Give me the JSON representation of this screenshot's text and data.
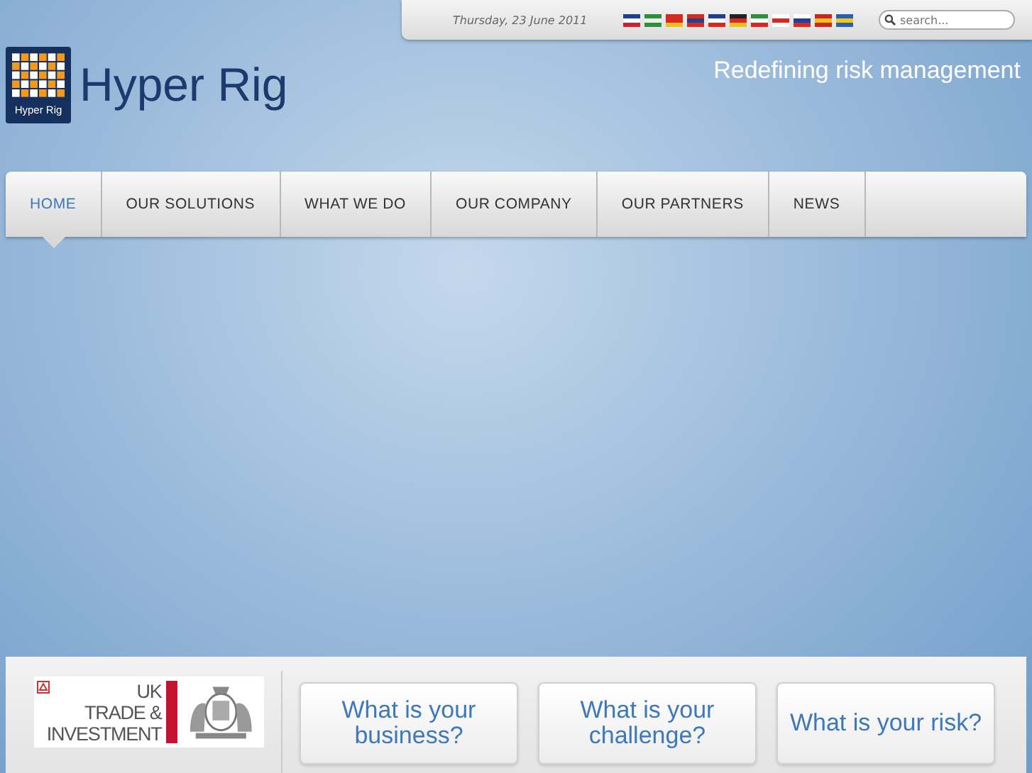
{
  "top_bar": {
    "date": "Thursday, 23 June 2011",
    "search": {
      "placeholder": "search..."
    }
  },
  "logo": {
    "badge_text": "Hyper Rig",
    "name": "Hyper Rig"
  },
  "tagline": "Redefining risk management",
  "nav": [
    {
      "label": "HOME",
      "selected": true
    },
    {
      "label": "OUR SOLUTIONS",
      "selected": false
    },
    {
      "label": "WHAT WE DO",
      "selected": false
    },
    {
      "label": "OUR COMPANY",
      "selected": false
    },
    {
      "label": "OUR PARTNERS",
      "selected": false
    },
    {
      "label": "NEWS",
      "selected": false
    }
  ],
  "partner_logo": {
    "lines": [
      "UK",
      "TRADE &",
      "INVESTMENT"
    ]
  },
  "cards": [
    "What is your business?",
    "What is your challenge?",
    "What is your risk?"
  ]
}
